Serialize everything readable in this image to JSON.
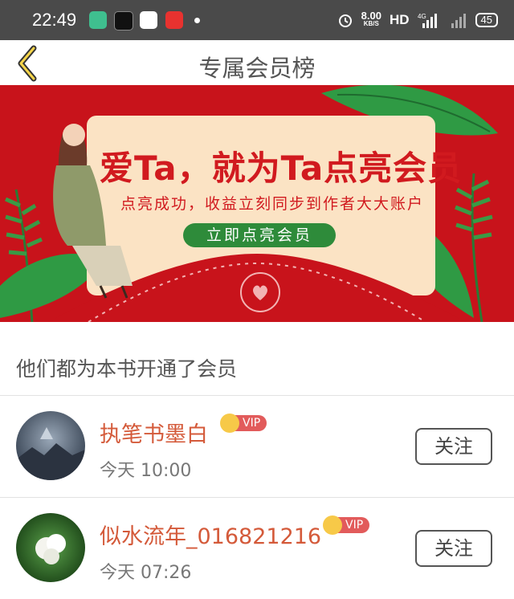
{
  "status_bar": {
    "time": "22:49",
    "net_speed_value": "8.00",
    "net_speed_unit": "KB/S",
    "hd_label": "HD",
    "network_label": "4G",
    "battery": "45"
  },
  "header": {
    "title": "专属会员榜"
  },
  "banner": {
    "headline": "爱Ta，就为Ta点亮会员",
    "subtitle": "点亮成功，收益立刻同步到作者大大账户",
    "button_label": "立即点亮会员"
  },
  "section": {
    "title": "他们都为本书开通了会员"
  },
  "members": [
    {
      "name": "执笔书墨白",
      "time": "今天 10:00",
      "badge": "VIP",
      "follow_label": "关注"
    },
    {
      "name": "似水流年_016821216",
      "time": "今天 07:26",
      "badge": "VIP",
      "follow_label": "关注"
    }
  ],
  "colors": {
    "banner_red": "#c8131b",
    "accent_green": "#2e8b3a",
    "name_orange": "#d45a3a",
    "vip_red": "#e25b5b",
    "crown_gold": "#f7c948"
  }
}
